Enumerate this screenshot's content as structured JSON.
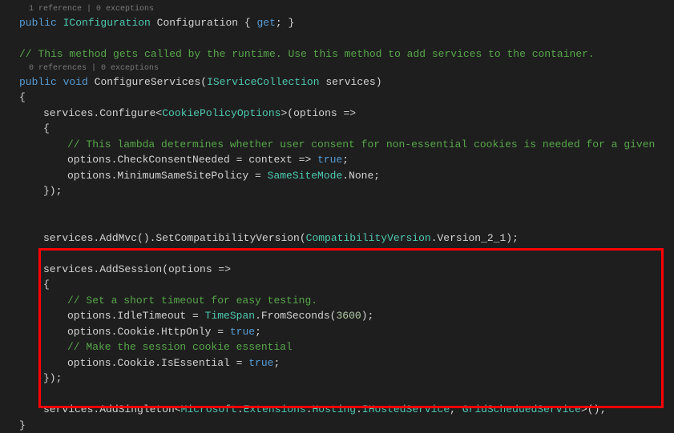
{
  "meta": {
    "line1": "1 reference | 0 exceptions",
    "line2": "0 references | 0 exceptions"
  },
  "code": {
    "public1": "public",
    "iconfiguration": "IConfiguration",
    "configuration_prop": " Configuration { ",
    "get": "get",
    "prop_end": "; }",
    "comment1": "// This method gets called by the runtime. Use this method to add services to the container.",
    "public2": "public",
    "void": "void",
    "configure_services": " ConfigureServices(",
    "iservicecollection": "IServiceCollection",
    "services_param": " services)",
    "brace_open": "{",
    "services_configure": "services.Configure<",
    "cookiepolicyoptions": "CookiePolicyOptions",
    "configure_end": ">(options =>",
    "brace_open2": "{",
    "comment2": "// This lambda determines whether user consent for non-essential cookies is needed for a given ",
    "checkconsent": "options.CheckConsentNeeded = context => ",
    "true1": "true",
    "semicolon1": ";",
    "minimumsame": "options.MinimumSameSitePolicy = ",
    "samesitemode": "SameSiteMode",
    "none": ".None;",
    "brace_close1": "});",
    "addmvc": "services.AddMvc().SetCompatibilityVersion(",
    "compatversion": "CompatibilityVersion",
    "version21": ".Version_2_1);",
    "addsession": "services.AddSession(options =>",
    "brace_open3": "{",
    "comment3": "// Set a short timeout for easy testing.",
    "idletimeout": "options.IdleTimeout = ",
    "timespan": "TimeSpan",
    "fromseconds": ".FromSeconds(",
    "num3600": "3600",
    "fromseconds_end": ");",
    "httponly": "options.Cookie.HttpOnly = ",
    "true2": "true",
    "semicolon2": ";",
    "comment4": "// Make the session cookie essential",
    "isessential": "options.Cookie.IsEssential = ",
    "true3": "true",
    "semicolon3": ";",
    "brace_close2": "});",
    "addsingleton": "services.AddSingleton<",
    "microsoft_ext": "Microsoft",
    "dot_ext": ".",
    "extensions": "Extensions",
    "hosting": "Hosting",
    "ihostedservice": "IHostedService",
    "comma": ", ",
    "gridscheduled": "GridScheduedService",
    "singleton_end": ">();",
    "brace_close3": "}"
  }
}
